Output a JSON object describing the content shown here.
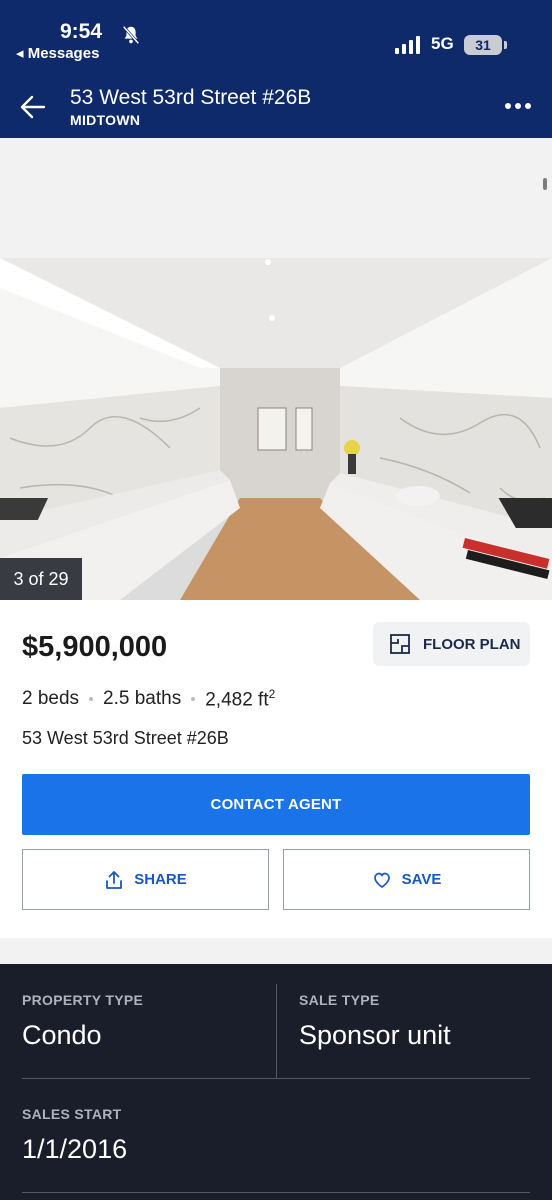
{
  "status_bar": {
    "time": "9:54",
    "back_app": "◂ Messages",
    "network": "5G",
    "battery": "31"
  },
  "header": {
    "title": "53 West 53rd Street #26B",
    "subtitle": "MIDTOWN"
  },
  "photo": {
    "counter": "3 of 29"
  },
  "listing": {
    "price": "$5,900,000",
    "floor_plan_label": "FLOOR PLAN",
    "beds": "2 beds",
    "baths": "2.5 baths",
    "area": "2,482 ft",
    "area_unit_sup": "2",
    "address": "53 West 53rd Street #26B",
    "contact_label": "CONTACT AGENT",
    "share_label": "SHARE",
    "save_label": "SAVE"
  },
  "facts": {
    "property_type_label": "PROPERTY TYPE",
    "property_type_value": "Condo",
    "sale_type_label": "SALE TYPE",
    "sale_type_value": "Sponsor unit",
    "sales_start_label": "SALES START",
    "sales_start_value": "1/1/2016"
  },
  "colors": {
    "header_bg": "#0f2a6b",
    "primary_button": "#1a73e8",
    "link_blue": "#1a56c4",
    "facts_bg": "#1a1e2b"
  }
}
